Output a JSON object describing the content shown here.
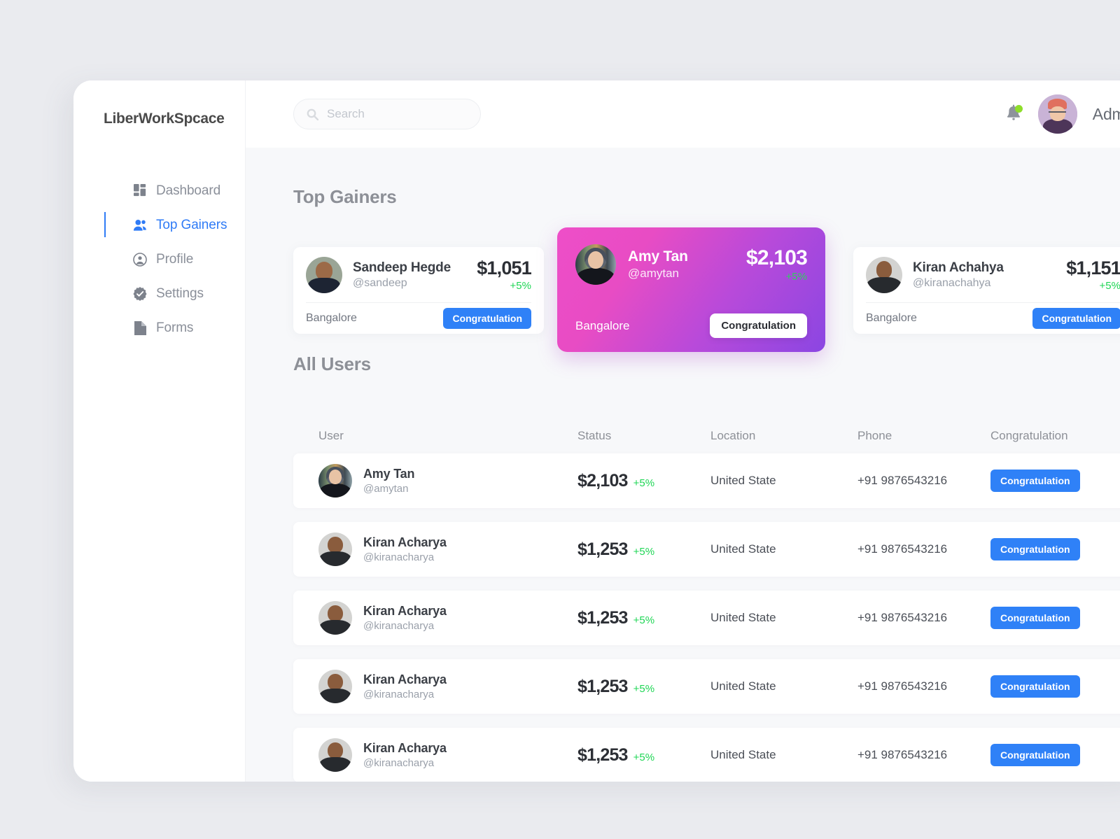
{
  "brand": "LiberWorkSpcace",
  "sidebar": {
    "items": [
      {
        "label": "Dashboard",
        "icon": "dashboard-icon",
        "active": false
      },
      {
        "label": "Top Gainers",
        "icon": "users-icon",
        "active": true
      },
      {
        "label": "Profile",
        "icon": "profile-icon",
        "active": false
      },
      {
        "label": "Settings",
        "icon": "settings-icon",
        "active": false
      },
      {
        "label": "Forms",
        "icon": "document-icon",
        "active": false
      }
    ]
  },
  "topbar": {
    "search": {
      "value": "",
      "placeholder": "Search",
      "icon": "search-icon"
    },
    "notification": {
      "icon": "bell-icon",
      "has_unread": true,
      "dot_color": "#8ede2a"
    },
    "user": {
      "name": "Admin",
      "avatar": "admin-avatar"
    }
  },
  "sections": {
    "top_gainers_title": "Top Gainers",
    "all_users_title": "All Users"
  },
  "top_gainers": [
    {
      "name": "Sandeep Hegde",
      "handle": "@sandeep",
      "amount": "$1,051",
      "change": "+5%",
      "location": "Bangalore",
      "button": "Congratulation",
      "featured": false
    },
    {
      "name": "Amy Tan",
      "handle": "@amytan",
      "amount": "$2,103",
      "change": "+5%",
      "location": "Bangalore",
      "button": "Congratulation",
      "featured": true
    },
    {
      "name": "Kiran Achahya",
      "handle": "@kiranachahya",
      "amount": "$1,151",
      "change": "+5%",
      "location": "Bangalore",
      "button": "Congratulation",
      "featured": false
    }
  ],
  "table": {
    "columns": [
      "User",
      "Status",
      "Location",
      "Phone",
      "Congratulation"
    ],
    "rows": [
      {
        "name": "Amy Tan",
        "handle": "@amytan",
        "amount": "$2,103",
        "change": "+5%",
        "location": "United State",
        "phone": "+91 9876543216",
        "button": "Congratulation"
      },
      {
        "name": "Kiran Acharya",
        "handle": "@kiranacharya",
        "amount": "$1,253",
        "change": "+5%",
        "location": "United State",
        "phone": "+91 9876543216",
        "button": "Congratulation"
      },
      {
        "name": "Kiran Acharya",
        "handle": "@kiranacharya",
        "amount": "$1,253",
        "change": "+5%",
        "location": "United State",
        "phone": "+91 9876543216",
        "button": "Congratulation"
      },
      {
        "name": "Kiran Acharya",
        "handle": "@kiranacharya",
        "amount": "$1,253",
        "change": "+5%",
        "location": "United State",
        "phone": "+91 9876543216",
        "button": "Congratulation"
      },
      {
        "name": "Kiran Acharya",
        "handle": "@kiranacharya",
        "amount": "$1,253",
        "change": "+5%",
        "location": "United State",
        "phone": "+91 9876543216",
        "button": "Congratulation"
      }
    ]
  },
  "colors": {
    "accent_blue": "#2f81f7",
    "positive_green": "#1fd655",
    "gradient_start": "#ee4ec8",
    "gradient_end": "#8b46e2",
    "page_background": "#eaebef",
    "content_background": "#f7f8fa"
  }
}
